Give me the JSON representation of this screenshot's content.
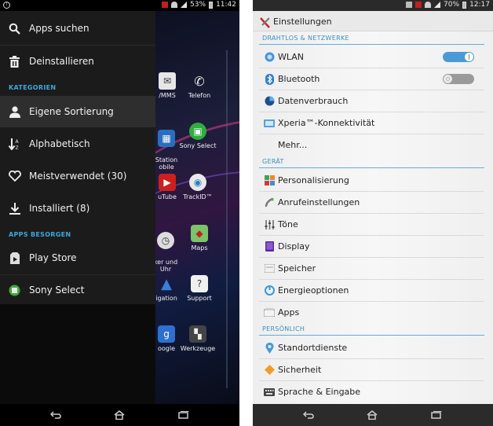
{
  "left_phone": {
    "status_bar": {
      "battery": "53%",
      "time": "11:42"
    },
    "drawer": {
      "top_items": [
        {
          "label": "Apps suchen",
          "icon": "search-icon"
        },
        {
          "label": "Deinstallieren",
          "icon": "trash-icon"
        }
      ],
      "section_kategorien": "KATEGORIEN",
      "category_items": [
        {
          "label": "Eigene Sortierung",
          "icon": "person-icon",
          "selected": true
        },
        {
          "label": "Alphabetisch",
          "icon": "sort-alpha-icon"
        },
        {
          "label": "Meistverwendet (30)",
          "icon": "heart-icon"
        },
        {
          "label": "Installiert (8)",
          "icon": "download-icon"
        }
      ],
      "section_apps": "APPS BESORGEN",
      "store_items": [
        {
          "label": "Play Store",
          "icon": "play-store-icon"
        },
        {
          "label": "Sony Select",
          "icon": "sony-select-icon"
        }
      ]
    },
    "home_apps": [
      {
        "label": "/MMS",
        "icon": "messaging-icon"
      },
      {
        "label": "Telefon",
        "icon": "phone-icon"
      },
      {
        "label": "Station\nobile",
        "icon": "station-icon"
      },
      {
        "label": "Sony Select",
        "icon": "sony-select-icon"
      },
      {
        "label": "uTube",
        "icon": "youtube-icon"
      },
      {
        "label": "TrackID™",
        "icon": "trackid-icon"
      },
      {
        "label": "ker und\nUhr",
        "icon": "clock-icon"
      },
      {
        "label": "Maps",
        "icon": "maps-icon"
      },
      {
        "label": "igation",
        "icon": "navigation-icon"
      },
      {
        "label": "Support",
        "icon": "support-icon"
      },
      {
        "label": "oogle",
        "icon": "google-icon"
      },
      {
        "label": "Werkzeuge",
        "icon": "tools-icon"
      }
    ]
  },
  "right_phone": {
    "status_bar": {
      "battery": "70%",
      "time": "12:17"
    },
    "title": "Einstellungen",
    "section_wireless": "DRAHTLOS & NETZWERKE",
    "wireless_items": [
      {
        "label": "WLAN",
        "icon": "wifi-icon",
        "toggle": "on"
      },
      {
        "label": "Bluetooth",
        "icon": "bluetooth-icon",
        "toggle": "off"
      },
      {
        "label": "Datenverbrauch",
        "icon": "data-usage-icon"
      },
      {
        "label": "Xperia™-Konnektivität",
        "icon": "xperia-connectivity-icon"
      },
      {
        "label": "Mehr...",
        "icon": ""
      }
    ],
    "section_device": "GERÄT",
    "device_items": [
      {
        "label": "Personalisierung",
        "icon": "personalization-icon"
      },
      {
        "label": "Anrufeinstellungen",
        "icon": "call-settings-icon"
      },
      {
        "label": "Töne",
        "icon": "sound-icon"
      },
      {
        "label": "Display",
        "icon": "display-icon"
      },
      {
        "label": "Speicher",
        "icon": "storage-icon"
      },
      {
        "label": "Energieoptionen",
        "icon": "power-icon"
      },
      {
        "label": "Apps",
        "icon": "apps-icon"
      }
    ],
    "section_personal": "PERSÖNLICH",
    "personal_items": [
      {
        "label": "Standortdienste",
        "icon": "location-icon"
      },
      {
        "label": "Sicherheit",
        "icon": "security-icon"
      },
      {
        "label": "Sprache & Eingabe",
        "icon": "keyboard-icon"
      }
    ]
  },
  "colors": {
    "accent": "#3fa7de",
    "toggle_on": "#4a9ad8",
    "drawer_bg": "#1b1b1b"
  }
}
